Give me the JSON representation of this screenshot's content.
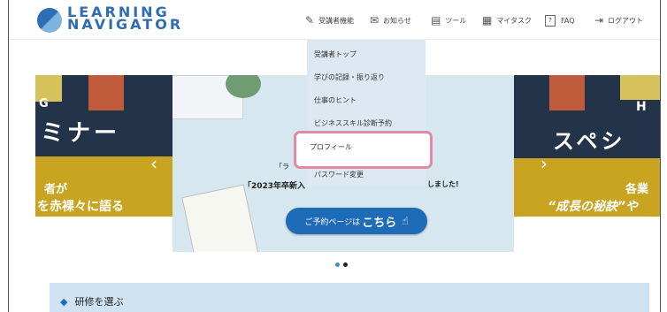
{
  "logo": {
    "line1": "LEARNING",
    "line2": "NAVIGATOR"
  },
  "nav": {
    "items": [
      {
        "label": "受講者機能",
        "icon": "pencil-icon"
      },
      {
        "label": "お知らせ",
        "icon": "mail-icon"
      },
      {
        "label": "ツール",
        "icon": "document-icon"
      },
      {
        "label": "マイタスク",
        "icon": "calendar-icon"
      },
      {
        "label": "FAQ",
        "icon": "question-icon",
        "glyph": "?"
      },
      {
        "label": "ログアウト",
        "icon": "logout-icon"
      }
    ]
  },
  "dropdown": {
    "items": [
      "受講者トップ",
      "学びの記録・振り返り",
      "仕事のヒント",
      "ビジネススキル診断予約",
      "プロフィール",
      "パスワード変更"
    ]
  },
  "hero": {
    "left": {
      "tag": "G",
      "title": "ミナー",
      "sub1": "者が",
      "sub2": "を赤裸々に語る"
    },
    "center": {
      "line1": "「ラ",
      "line2": "「2023年卒新入",
      "line2_end": "しました!",
      "cta_prefix": "ご予約ページは",
      "cta_strong": "こちら"
    },
    "right": {
      "tag": "H",
      "title": "スペシ",
      "sub1": "各業",
      "sub2": "“成長の秘訣”や"
    }
  },
  "section": {
    "title": "研修を選ぶ"
  },
  "colors": {
    "brand": "#2f6db2",
    "cta": "#1e6bb8",
    "highlight": "#e08aa6",
    "dropdown_bg": "#dde8f2"
  }
}
